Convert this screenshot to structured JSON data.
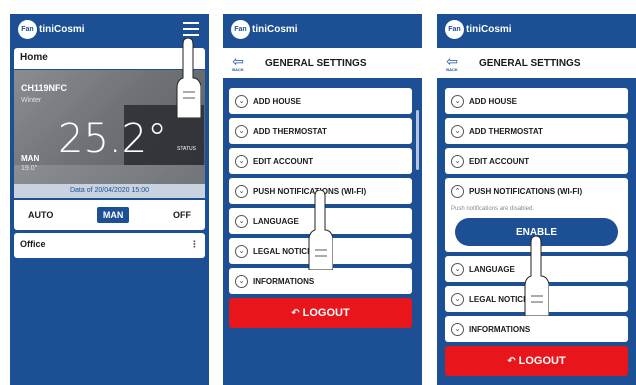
{
  "brand": {
    "logo_mark": "Fan",
    "logo_text": "tiniCosmi"
  },
  "screen1": {
    "house_label": "Home",
    "thermostat": {
      "name": "CH119NFC",
      "season": "Winter",
      "temperature": "25.2°",
      "mode": "MAN",
      "setpoint": "19.0°",
      "status_label": "STATUS",
      "data_timestamp": "Data of 20/04/2020 15:00"
    },
    "modes": [
      "AUTO",
      "MAN",
      "OFF"
    ],
    "active_mode": "MAN",
    "office_label": "Office",
    "kebab": "⋮"
  },
  "screen2": {
    "back_label": "BACK",
    "title": "GENERAL SETTINGS",
    "items": [
      "ADD HOUSE",
      "ADD THERMOSTAT",
      "EDIT ACCOUNT",
      "PUSH NOTIFICATIONS (WI-FI)",
      "LANGUAGE",
      "LEGAL NOTICES",
      "INFORMATIONS"
    ],
    "logout": "LOGOUT"
  },
  "screen3": {
    "back_label": "BACK",
    "title": "GENERAL SETTINGS",
    "items_before": [
      "ADD HOUSE",
      "ADD THERMOSTAT",
      "EDIT ACCOUNT"
    ],
    "expanded_item": "PUSH NOTIFICATIONS (WI-FI)",
    "expanded_note": "Push notifications are disabled.",
    "enable_label": "ENABLE",
    "items_after": [
      "LANGUAGE",
      "LEGAL NOTICES",
      "INFORMATIONS"
    ],
    "logout": "LOGOUT"
  },
  "icons": {
    "menu": "hamburger-icon",
    "back": "back-icon",
    "chevron_down": "chevron-down-icon",
    "chevron_up": "chevron-up-icon",
    "logout": "logout-icon",
    "hand": "hand-pointer-icon"
  },
  "colors": {
    "brand_blue": "#1c4f94",
    "logout_red": "#e8151b",
    "white": "#ffffff"
  }
}
